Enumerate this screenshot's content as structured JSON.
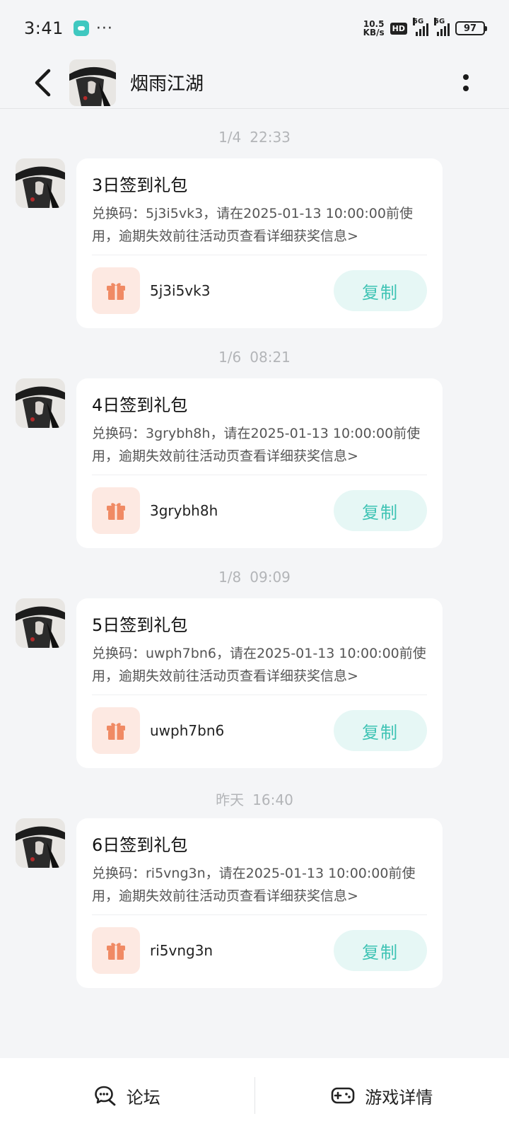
{
  "status_bar": {
    "time": "3:41",
    "dots": "···",
    "net_speed_value": "10.5",
    "net_speed_unit": "KB/s",
    "hd_label": "HD",
    "signal1_label": "5G",
    "signal2_label": "5G",
    "battery": "97"
  },
  "header": {
    "title": "烟雨江湖"
  },
  "messages": [
    {
      "date": "1/4",
      "time": "22:33",
      "title": "3日签到礼包",
      "description": "兑换码：5j3i5vk3，请在2025-01-13 10:00:00前使用，逾期失效前往活动页查看详细获奖信息>",
      "code": "5j3i5vk3",
      "copy_label": "复制"
    },
    {
      "date": "1/6",
      "time": "08:21",
      "title": "4日签到礼包",
      "description": "兑换码：3grybh8h，请在2025-01-13 10:00:00前使用，逾期失效前往活动页查看详细获奖信息>",
      "code": "3grybh8h",
      "copy_label": "复制"
    },
    {
      "date": "1/8",
      "time": "09:09",
      "title": "5日签到礼包",
      "description": "兑换码：uwph7bn6，请在2025-01-13 10:00:00前使用，逾期失效前往活动页查看详细获奖信息>",
      "code": "uwph7bn6",
      "copy_label": "复制"
    },
    {
      "date": "昨天",
      "time": "16:40",
      "title": "6日签到礼包",
      "description": "兑换码：ri5vng3n，请在2025-01-13 10:00:00前使用，逾期失效前往活动页查看详细获奖信息>",
      "code": "ri5vng3n",
      "copy_label": "复制"
    }
  ],
  "bottom_bar": {
    "forum_label": "论坛",
    "game_details_label": "游戏详情"
  },
  "colors": {
    "accent": "#3ec3b4",
    "copy_bg": "#e6f7f5",
    "gift": "#f08a64",
    "gift_bg": "#fde9e2",
    "background": "#f4f5f7"
  }
}
